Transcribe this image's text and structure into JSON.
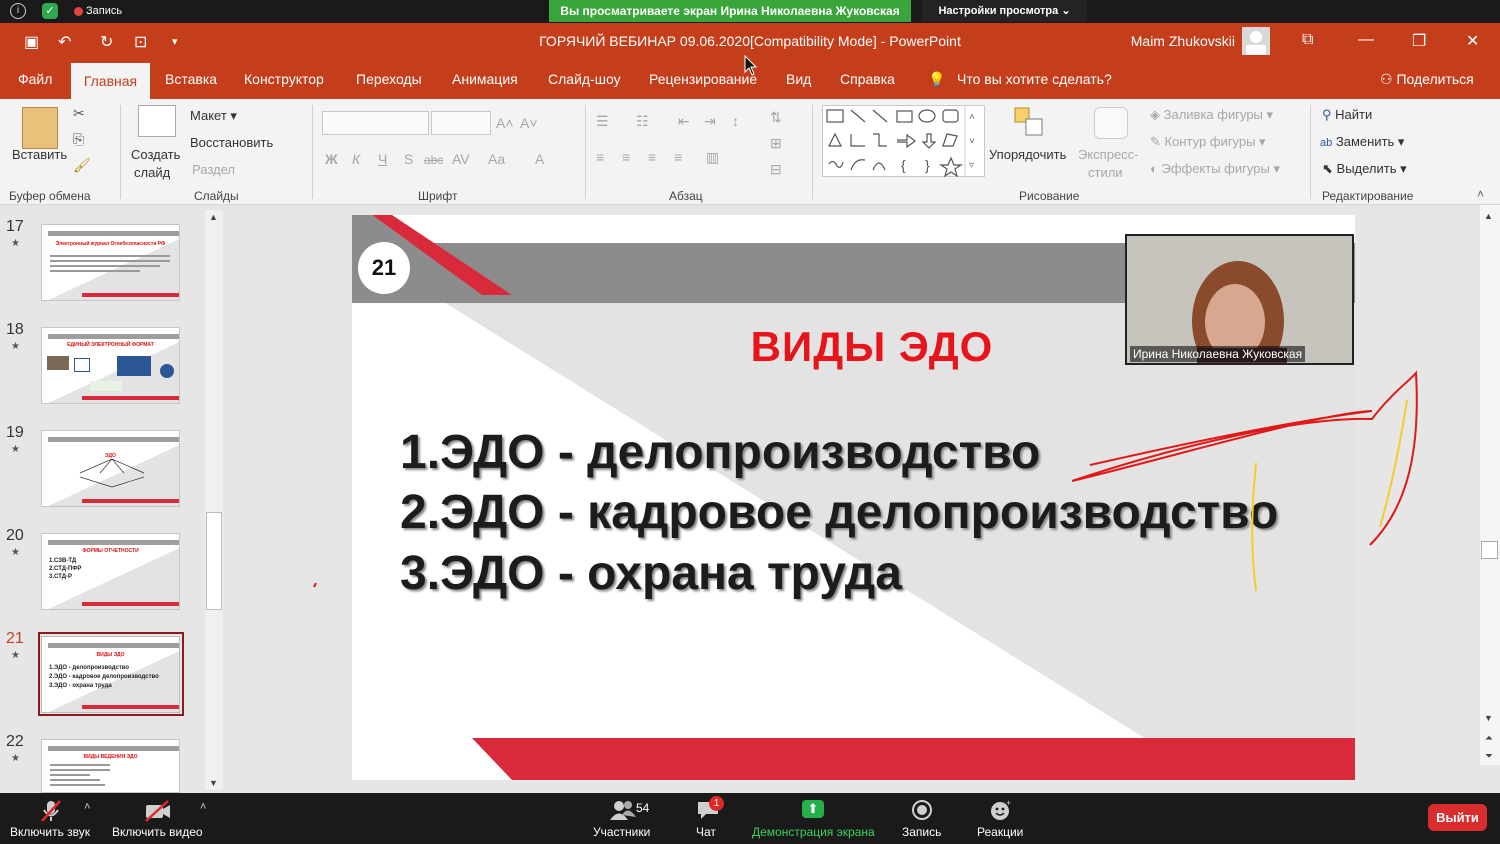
{
  "zoom_top": {
    "record_label": "Запись",
    "share_banner": "Вы просматриваете экран Ирина Николаевна Жуковская",
    "view_options": "Настройки просмотра ⌄"
  },
  "window": {
    "title": "ГОРЯЧИЙ ВЕБИНАР 09.06.2020[Compatibility Mode]  -  PowerPoint",
    "user": "Maim Zhukovskii"
  },
  "tabs": [
    "Файл",
    "Главная",
    "Вставка",
    "Конструктор",
    "Переходы",
    "Анимация",
    "Слайд-шоу",
    "Рецензирование",
    "Вид",
    "Справка"
  ],
  "tell_me": "Что вы хотите сделать?",
  "share": "Поделиться",
  "ribbon": {
    "paste": "Вставить",
    "clipboard_group": "Буфер обмена",
    "new_slide": "Создать",
    "new_slide2": "слайд",
    "layout": "Макет",
    "reset": "Восстановить",
    "section": "Раздел",
    "slides_group": "Слайды",
    "font_group": "Шрифт",
    "paragraph_group": "Абзац",
    "arrange": "Упорядочить",
    "quick_styles": "Экспресс-",
    "quick_styles2": "стили",
    "shape_fill": "Заливка фигуры",
    "shape_outline": "Контур фигуры",
    "shape_effects": "Эффекты фигуры",
    "drawing_group": "Рисование",
    "find": "Найти",
    "replace": "Заменить",
    "select": "Выделить",
    "editing_group": "Редактирование",
    "font_buttons": [
      "Ж",
      "К",
      "Ч",
      "S",
      "abc",
      "AV",
      "Aa",
      "A"
    ]
  },
  "thumbnails": [
    {
      "num": "17",
      "title": "Электронный журнал Огнебезопасности РФ",
      "lines": []
    },
    {
      "num": "18",
      "title": "ЕДИНЫЙ ЭЛЕКТРОННЫЙ ФОРМАТ",
      "lines": []
    },
    {
      "num": "19",
      "title": "ЭДО",
      "lines": []
    },
    {
      "num": "20",
      "title": "ФОРМЫ ОТЧЕТНОСТИ",
      "lines": [
        "1.СЗВ-ТД",
        "2.СТД-ПФР",
        "3.СТД-Р"
      ]
    },
    {
      "num": "21",
      "title": "ВИДЫ ЭДО",
      "lines": [
        "1.ЭДО - делопроизводство",
        "2.ЭДО - кадровое делопроизводство",
        "3.ЭДО - охрана труда"
      ]
    },
    {
      "num": "22",
      "title": "ВИДЫ ВЕДЕНИЯ ЭДО",
      "lines": []
    }
  ],
  "slide": {
    "number": "21",
    "title": "ВИДЫ ЭДО",
    "items": [
      "1.ЭДО - делопроизводство",
      "2.ЭДО - кадровое делопроизводство",
      "3.ЭДО - охрана труда"
    ]
  },
  "webcam": {
    "name": "Ирина Николаевна Жуковская"
  },
  "zoom_bottom": {
    "mic": "Включить звук",
    "video": "Включить видео",
    "participants": "Участники",
    "participants_count": "54",
    "chat": "Чат",
    "chat_badge": "1",
    "share": "Демонстрация экрана",
    "record": "Запись",
    "reactions": "Реакции",
    "leave": "Выйти"
  },
  "colors": {
    "ppt_accent": "#c43e1c",
    "slide_red": "#d92a3c",
    "zoom_green": "#3aa53a"
  }
}
